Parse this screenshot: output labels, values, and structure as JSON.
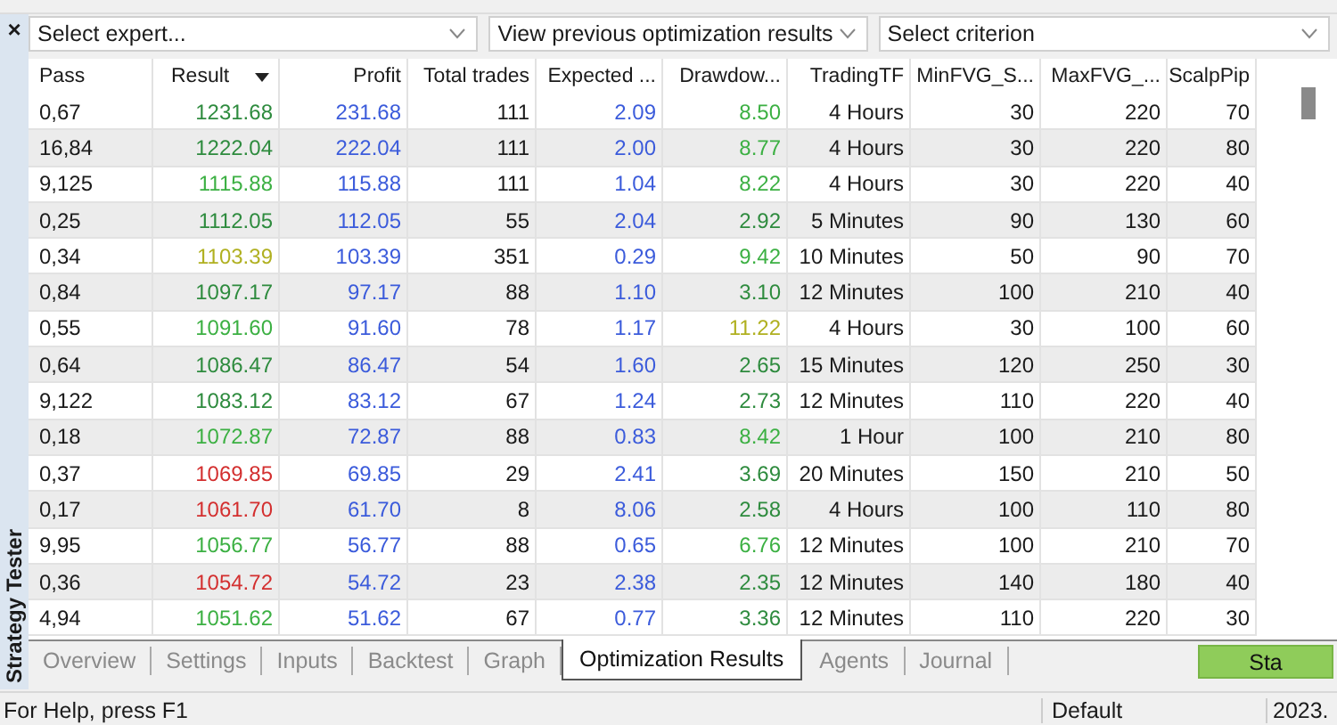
{
  "panel": {
    "close": "×",
    "title": "Strategy Tester"
  },
  "selectors": [
    {
      "value": "Select expert..."
    },
    {
      "value": "View previous optimization results"
    },
    {
      "value": "Select criterion"
    }
  ],
  "table": {
    "columns": [
      {
        "label": "Pass",
        "sorted": false
      },
      {
        "label": "Result",
        "sorted": true
      },
      {
        "label": "Profit",
        "sorted": false
      },
      {
        "label": "Total trades",
        "sorted": false
      },
      {
        "label": "Expected ...",
        "sorted": false
      },
      {
        "label": "Drawdow...",
        "sorted": false
      },
      {
        "label": "TradingTF",
        "sorted": false
      },
      {
        "label": "MinFVG_S...",
        "sorted": false
      },
      {
        "label": "MaxFVG_...",
        "sorted": false
      },
      {
        "label": "ScalpPip",
        "sorted": false
      }
    ],
    "rows": [
      {
        "pass": "0,67",
        "result": {
          "text": "1231.68",
          "color": "#2e8b3e"
        },
        "profit": "231.68",
        "total_trades": "111",
        "expected": "2.09",
        "drawdown": {
          "text": "8.50",
          "color": "#3cb043"
        },
        "trading_tf": "4 Hours",
        "min_fvg": "30",
        "max_fvg": "220",
        "scalp_pip": "70"
      },
      {
        "pass": "16,84",
        "result": {
          "text": "1222.04",
          "color": "#2e8b3e"
        },
        "profit": "222.04",
        "total_trades": "111",
        "expected": "2.00",
        "drawdown": {
          "text": "8.77",
          "color": "#3cb043"
        },
        "trading_tf": "4 Hours",
        "min_fvg": "30",
        "max_fvg": "220",
        "scalp_pip": "80"
      },
      {
        "pass": "9,125",
        "result": {
          "text": "1115.88",
          "color": "#3cb043"
        },
        "profit": "115.88",
        "total_trades": "111",
        "expected": "1.04",
        "drawdown": {
          "text": "8.22",
          "color": "#3cb043"
        },
        "trading_tf": "4 Hours",
        "min_fvg": "30",
        "max_fvg": "220",
        "scalp_pip": "40"
      },
      {
        "pass": "0,25",
        "result": {
          "text": "1112.05",
          "color": "#2e8b3e"
        },
        "profit": "112.05",
        "total_trades": "55",
        "expected": "2.04",
        "drawdown": {
          "text": "2.92",
          "color": "#2e8b3e"
        },
        "trading_tf": "5 Minutes",
        "min_fvg": "90",
        "max_fvg": "130",
        "scalp_pip": "60"
      },
      {
        "pass": "0,34",
        "result": {
          "text": "1103.39",
          "color": "#b0b020"
        },
        "profit": "103.39",
        "total_trades": "351",
        "expected": "0.29",
        "drawdown": {
          "text": "9.42",
          "color": "#3cb043"
        },
        "trading_tf": "10 Minutes",
        "min_fvg": "50",
        "max_fvg": "90",
        "scalp_pip": "70"
      },
      {
        "pass": "0,84",
        "result": {
          "text": "1097.17",
          "color": "#2e8b3e"
        },
        "profit": "97.17",
        "total_trades": "88",
        "expected": "1.10",
        "drawdown": {
          "text": "3.10",
          "color": "#2e8b3e"
        },
        "trading_tf": "12 Minutes",
        "min_fvg": "100",
        "max_fvg": "210",
        "scalp_pip": "40"
      },
      {
        "pass": "0,55",
        "result": {
          "text": "1091.60",
          "color": "#3cb043"
        },
        "profit": "91.60",
        "total_trades": "78",
        "expected": "1.17",
        "drawdown": {
          "text": "11.22",
          "color": "#b0b020"
        },
        "trading_tf": "4 Hours",
        "min_fvg": "30",
        "max_fvg": "100",
        "scalp_pip": "60"
      },
      {
        "pass": "0,64",
        "result": {
          "text": "1086.47",
          "color": "#2e8b3e"
        },
        "profit": "86.47",
        "total_trades": "54",
        "expected": "1.60",
        "drawdown": {
          "text": "2.65",
          "color": "#2e8b3e"
        },
        "trading_tf": "15 Minutes",
        "min_fvg": "120",
        "max_fvg": "250",
        "scalp_pip": "30"
      },
      {
        "pass": "9,122",
        "result": {
          "text": "1083.12",
          "color": "#2e8b3e"
        },
        "profit": "83.12",
        "total_trades": "67",
        "expected": "1.24",
        "drawdown": {
          "text": "2.73",
          "color": "#2e8b3e"
        },
        "trading_tf": "12 Minutes",
        "min_fvg": "110",
        "max_fvg": "220",
        "scalp_pip": "40"
      },
      {
        "pass": "0,18",
        "result": {
          "text": "1072.87",
          "color": "#3cb043"
        },
        "profit": "72.87",
        "total_trades": "88",
        "expected": "0.83",
        "drawdown": {
          "text": "8.42",
          "color": "#3cb043"
        },
        "trading_tf": "1 Hour",
        "min_fvg": "100",
        "max_fvg": "210",
        "scalp_pip": "80"
      },
      {
        "pass": "0,37",
        "result": {
          "text": "1069.85",
          "color": "#d32f2f"
        },
        "profit": "69.85",
        "total_trades": "29",
        "expected": "2.41",
        "drawdown": {
          "text": "3.69",
          "color": "#2e8b3e"
        },
        "trading_tf": "20 Minutes",
        "min_fvg": "150",
        "max_fvg": "210",
        "scalp_pip": "50"
      },
      {
        "pass": "0,17",
        "result": {
          "text": "1061.70",
          "color": "#d32f2f"
        },
        "profit": "61.70",
        "total_trades": "8",
        "expected": "8.06",
        "drawdown": {
          "text": "2.58",
          "color": "#2e8b3e"
        },
        "trading_tf": "4 Hours",
        "min_fvg": "100",
        "max_fvg": "110",
        "scalp_pip": "80"
      },
      {
        "pass": "9,95",
        "result": {
          "text": "1056.77",
          "color": "#3cb043"
        },
        "profit": "56.77",
        "total_trades": "88",
        "expected": "0.65",
        "drawdown": {
          "text": "6.76",
          "color": "#3cb043"
        },
        "trading_tf": "12 Minutes",
        "min_fvg": "100",
        "max_fvg": "210",
        "scalp_pip": "70"
      },
      {
        "pass": "0,36",
        "result": {
          "text": "1054.72",
          "color": "#d32f2f"
        },
        "profit": "54.72",
        "total_trades": "23",
        "expected": "2.38",
        "drawdown": {
          "text": "2.35",
          "color": "#2e8b3e"
        },
        "trading_tf": "12 Minutes",
        "min_fvg": "140",
        "max_fvg": "180",
        "scalp_pip": "40"
      },
      {
        "pass": "4,94",
        "result": {
          "text": "1051.62",
          "color": "#3cb043"
        },
        "profit": "51.62",
        "total_trades": "67",
        "expected": "0.77",
        "drawdown": {
          "text": "3.36",
          "color": "#2e8b3e"
        },
        "trading_tf": "12 Minutes",
        "min_fvg": "110",
        "max_fvg": "220",
        "scalp_pip": "30"
      }
    ]
  },
  "tabs": [
    {
      "label": "Overview",
      "selected": false
    },
    {
      "label": "Settings",
      "selected": false
    },
    {
      "label": "Inputs",
      "selected": false
    },
    {
      "label": "Backtest",
      "selected": false
    },
    {
      "label": "Graph",
      "selected": false
    },
    {
      "label": "Optimization Results",
      "selected": true
    },
    {
      "label": "Agents",
      "selected": false
    },
    {
      "label": "Journal",
      "selected": false
    }
  ],
  "start_button": {
    "label": "Sta"
  },
  "status_bar": {
    "help": "For Help, press F1",
    "profile": "Default",
    "date": "2023."
  }
}
